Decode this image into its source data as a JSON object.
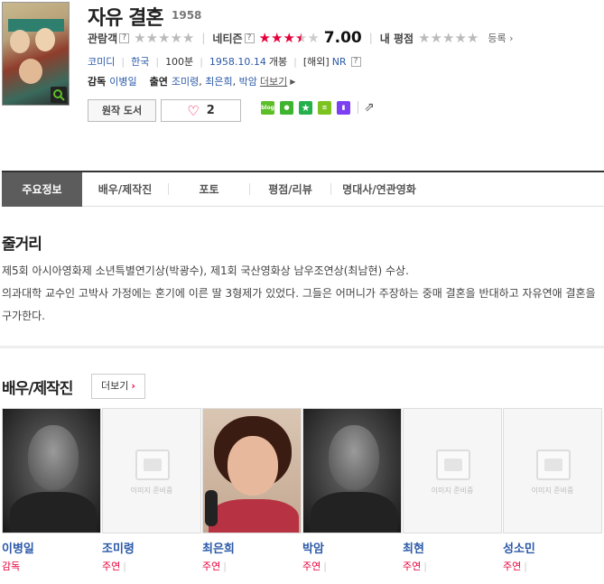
{
  "movie": {
    "title": "자유 결혼",
    "year": "1958",
    "ratings": {
      "audience_label": "관람객",
      "audience_help": "?",
      "netizen_label": "네티즌",
      "netizen_help": "?",
      "netizen_score": "7.00",
      "netizen_stars": 3.5,
      "my_label": "내 평점",
      "register": "등록"
    },
    "info": {
      "genre": "코미디",
      "country": "한국",
      "runtime": "100분",
      "release": "1958.10.14",
      "release_suffix": "개봉",
      "overseas": "[해외]",
      "rating_grade": "NR",
      "grade_help": "?"
    },
    "credits": {
      "director_label": "감독",
      "director": "이병일",
      "cast_label": "출연",
      "cast": [
        "조미령",
        "최은희",
        "박암"
      ],
      "more": "더보기"
    },
    "buttons": {
      "book": "원작 도서",
      "likes": "2"
    },
    "share_icons": [
      "blog-icon",
      "chat-icon",
      "star-icon",
      "list-icon",
      "bar-icon",
      "share-out-icon"
    ]
  },
  "tabs": [
    "주요정보",
    "배우/제작진",
    "포토",
    "평점/리뷰",
    "명대사/연관영화"
  ],
  "synopsis": {
    "title": "줄거리",
    "line1": "제5회 아시아영화제 소년특별연기상(박광수), 제1회 국산영화상 남우조연상(최남현) 수상.",
    "line2": " 의과대학 교수인 고박사 가정에는 혼기에 이른 딸 3형제가 있었다. 그들은 어머니가 주장하는 중매 결혼을 반대하고 자유연애 결혼을 구가한다."
  },
  "cast_section": {
    "title": "배우/제작진",
    "more": "더보기",
    "placeholder": "이미지 준비중",
    "people": [
      {
        "name": "이병일",
        "role": "감독",
        "photo": "dark"
      },
      {
        "name": "조미령",
        "role": "주연",
        "photo": "none"
      },
      {
        "name": "최은희",
        "role": "주연",
        "photo": "color"
      },
      {
        "name": "박암",
        "role": "주연",
        "photo": "dark"
      },
      {
        "name": "최현",
        "role": "주연",
        "photo": "none"
      },
      {
        "name": "성소민",
        "role": "주연",
        "photo": "none"
      }
    ]
  },
  "colors": {
    "accent": "#e6003a",
    "link": "#2b59a8",
    "tab_active": "#5c5c5c"
  }
}
